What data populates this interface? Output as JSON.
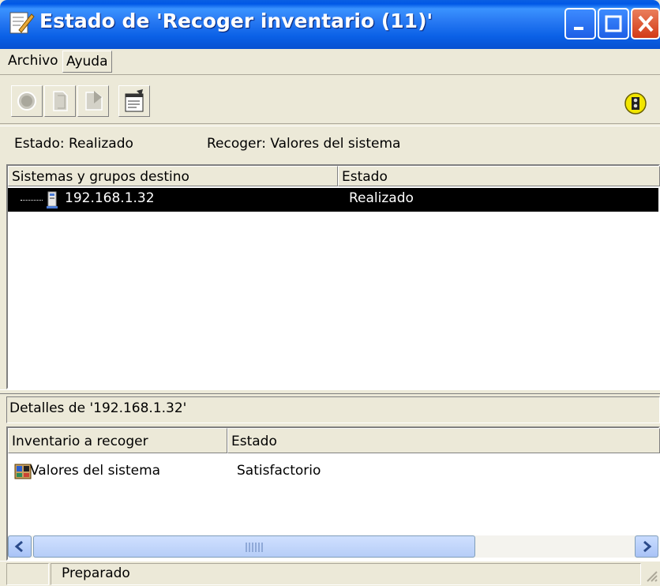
{
  "window": {
    "title": "Estado de 'Recoger inventario (11)'",
    "colors": {
      "titlebar": "#0a5fe3",
      "selection": "#000000",
      "window_bg": "#ece9d8"
    }
  },
  "menu": {
    "items": [
      "Archivo",
      "Ayuda"
    ]
  },
  "toolbar": {
    "buttons": [
      "stop-icon",
      "document-icon",
      "forward-icon",
      "properties-icon"
    ],
    "status_icon": "traffic-light-icon"
  },
  "status_line": {
    "estado": "Estado: Realizado",
    "recoger": "Recoger: Valores del sistema"
  },
  "upper_list": {
    "columns": [
      "Sistemas y grupos destino",
      "Estado"
    ],
    "rows": [
      {
        "system": "192.168.1.32",
        "estado": "Realizado",
        "selected": true
      }
    ]
  },
  "details": {
    "title": "Detalles de '192.168.1.32'",
    "columns": [
      "Inventario a recoger",
      "Estado"
    ],
    "rows": [
      {
        "inventario": "Valores del sistema",
        "estado": "Satisfactorio"
      }
    ]
  },
  "statusbar": {
    "text": "Preparado"
  }
}
